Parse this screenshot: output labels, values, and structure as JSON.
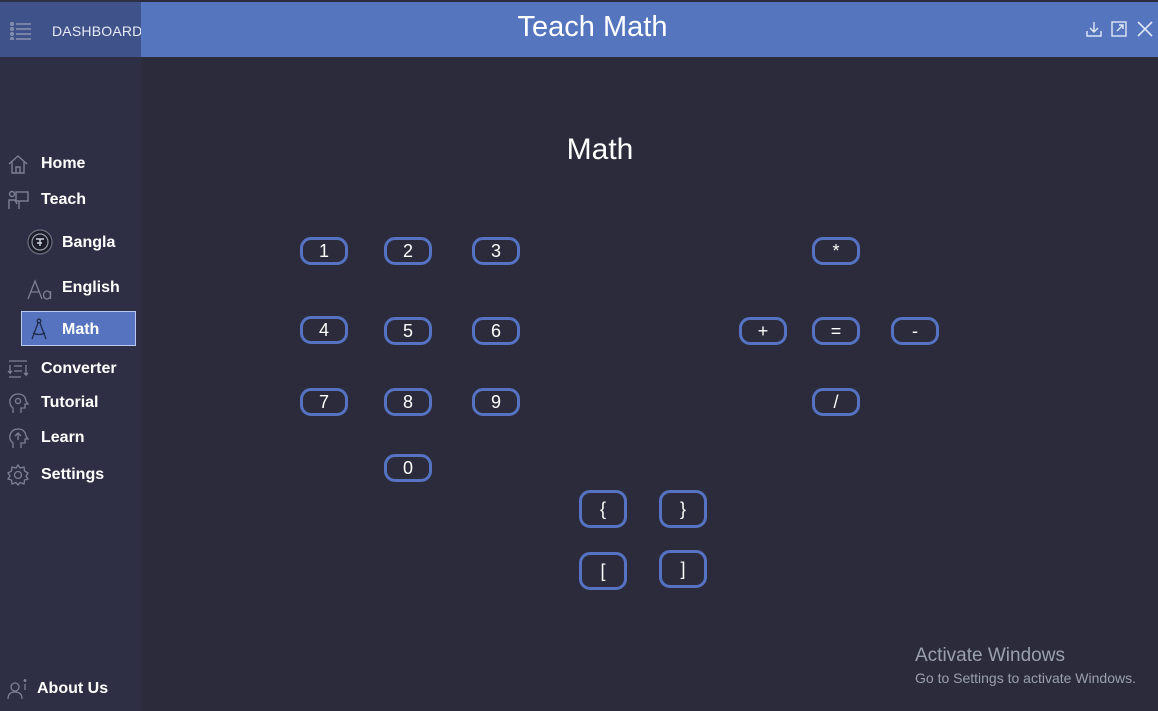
{
  "sidebar": {
    "header_label": "DASHBOARD",
    "items": [
      {
        "label": "Home",
        "icon": "home-icon"
      },
      {
        "label": "Teach",
        "icon": "teach-icon"
      },
      {
        "label": "Bangla",
        "icon": "bangla-icon"
      },
      {
        "label": "English",
        "icon": "english-icon"
      },
      {
        "label": "Math",
        "icon": "math-compass-icon"
      },
      {
        "label": "Converter",
        "icon": "converter-icon"
      },
      {
        "label": "Tutorial",
        "icon": "tutorial-icon"
      },
      {
        "label": "Learn",
        "icon": "learn-icon"
      },
      {
        "label": "Settings",
        "icon": "settings-icon"
      }
    ],
    "about_label": "About Us"
  },
  "titlebar": {
    "title": "Teach Math",
    "buttons": [
      "download-icon",
      "maximize-icon",
      "close-icon"
    ]
  },
  "main": {
    "title": "Math",
    "digits": [
      "1",
      "2",
      "3",
      "4",
      "5",
      "6",
      "7",
      "8",
      "9",
      "0"
    ],
    "operators": {
      "multiply": "*",
      "plus": "+",
      "equals": "=",
      "minus": "-",
      "divide": "/"
    },
    "brackets": {
      "brace_open": "{",
      "brace_close": "}",
      "bracket_open": "[",
      "bracket_close": "]"
    }
  },
  "watermark": {
    "line1": "Activate Windows",
    "line2": "Go to Settings to activate Windows."
  },
  "colors": {
    "sidebar_bg": "#2e2f44",
    "main_bg": "#2b2b3b",
    "titlebar_bg": "#5576bf",
    "accent": "#5573c2"
  }
}
